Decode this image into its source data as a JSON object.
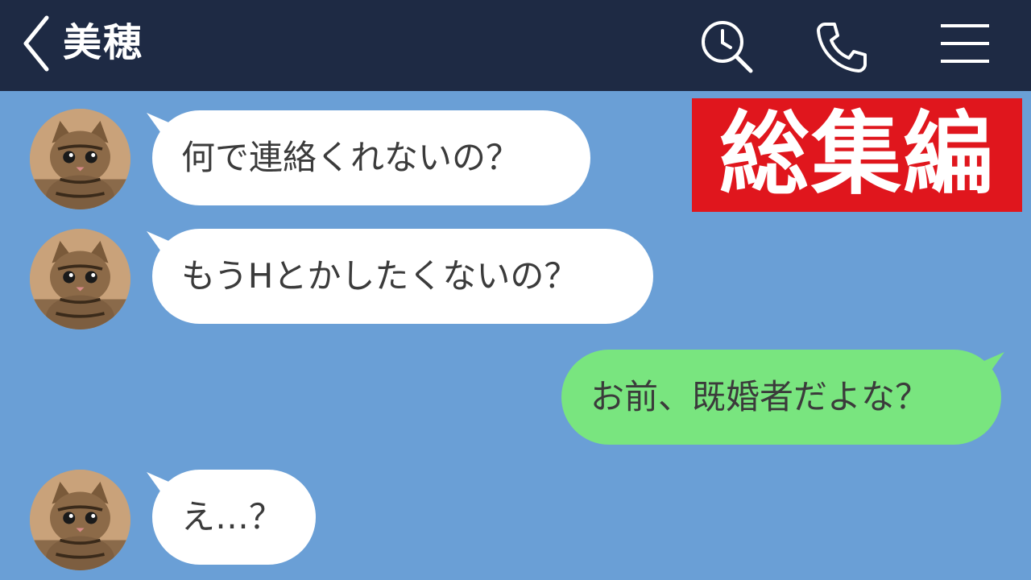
{
  "header": {
    "contact_name": "美穂",
    "icons": [
      "back-chevron-icon",
      "search-history-icon",
      "phone-icon",
      "menu-icon"
    ]
  },
  "badge": {
    "label": "総集編",
    "color": "#e0161d"
  },
  "colors": {
    "header_bg": "#1e2a44",
    "chat_bg": "#6a9fd6",
    "incoming_bubble": "#ffffff",
    "outgoing_bubble": "#79e57f"
  },
  "messages": [
    {
      "side": "incoming",
      "text": "何で連絡くれないの？"
    },
    {
      "side": "incoming",
      "text": "もうHとかしたくないの？"
    },
    {
      "side": "outgoing",
      "text": "お前、既婚者だよな？"
    },
    {
      "side": "incoming",
      "text": "え…？"
    }
  ]
}
